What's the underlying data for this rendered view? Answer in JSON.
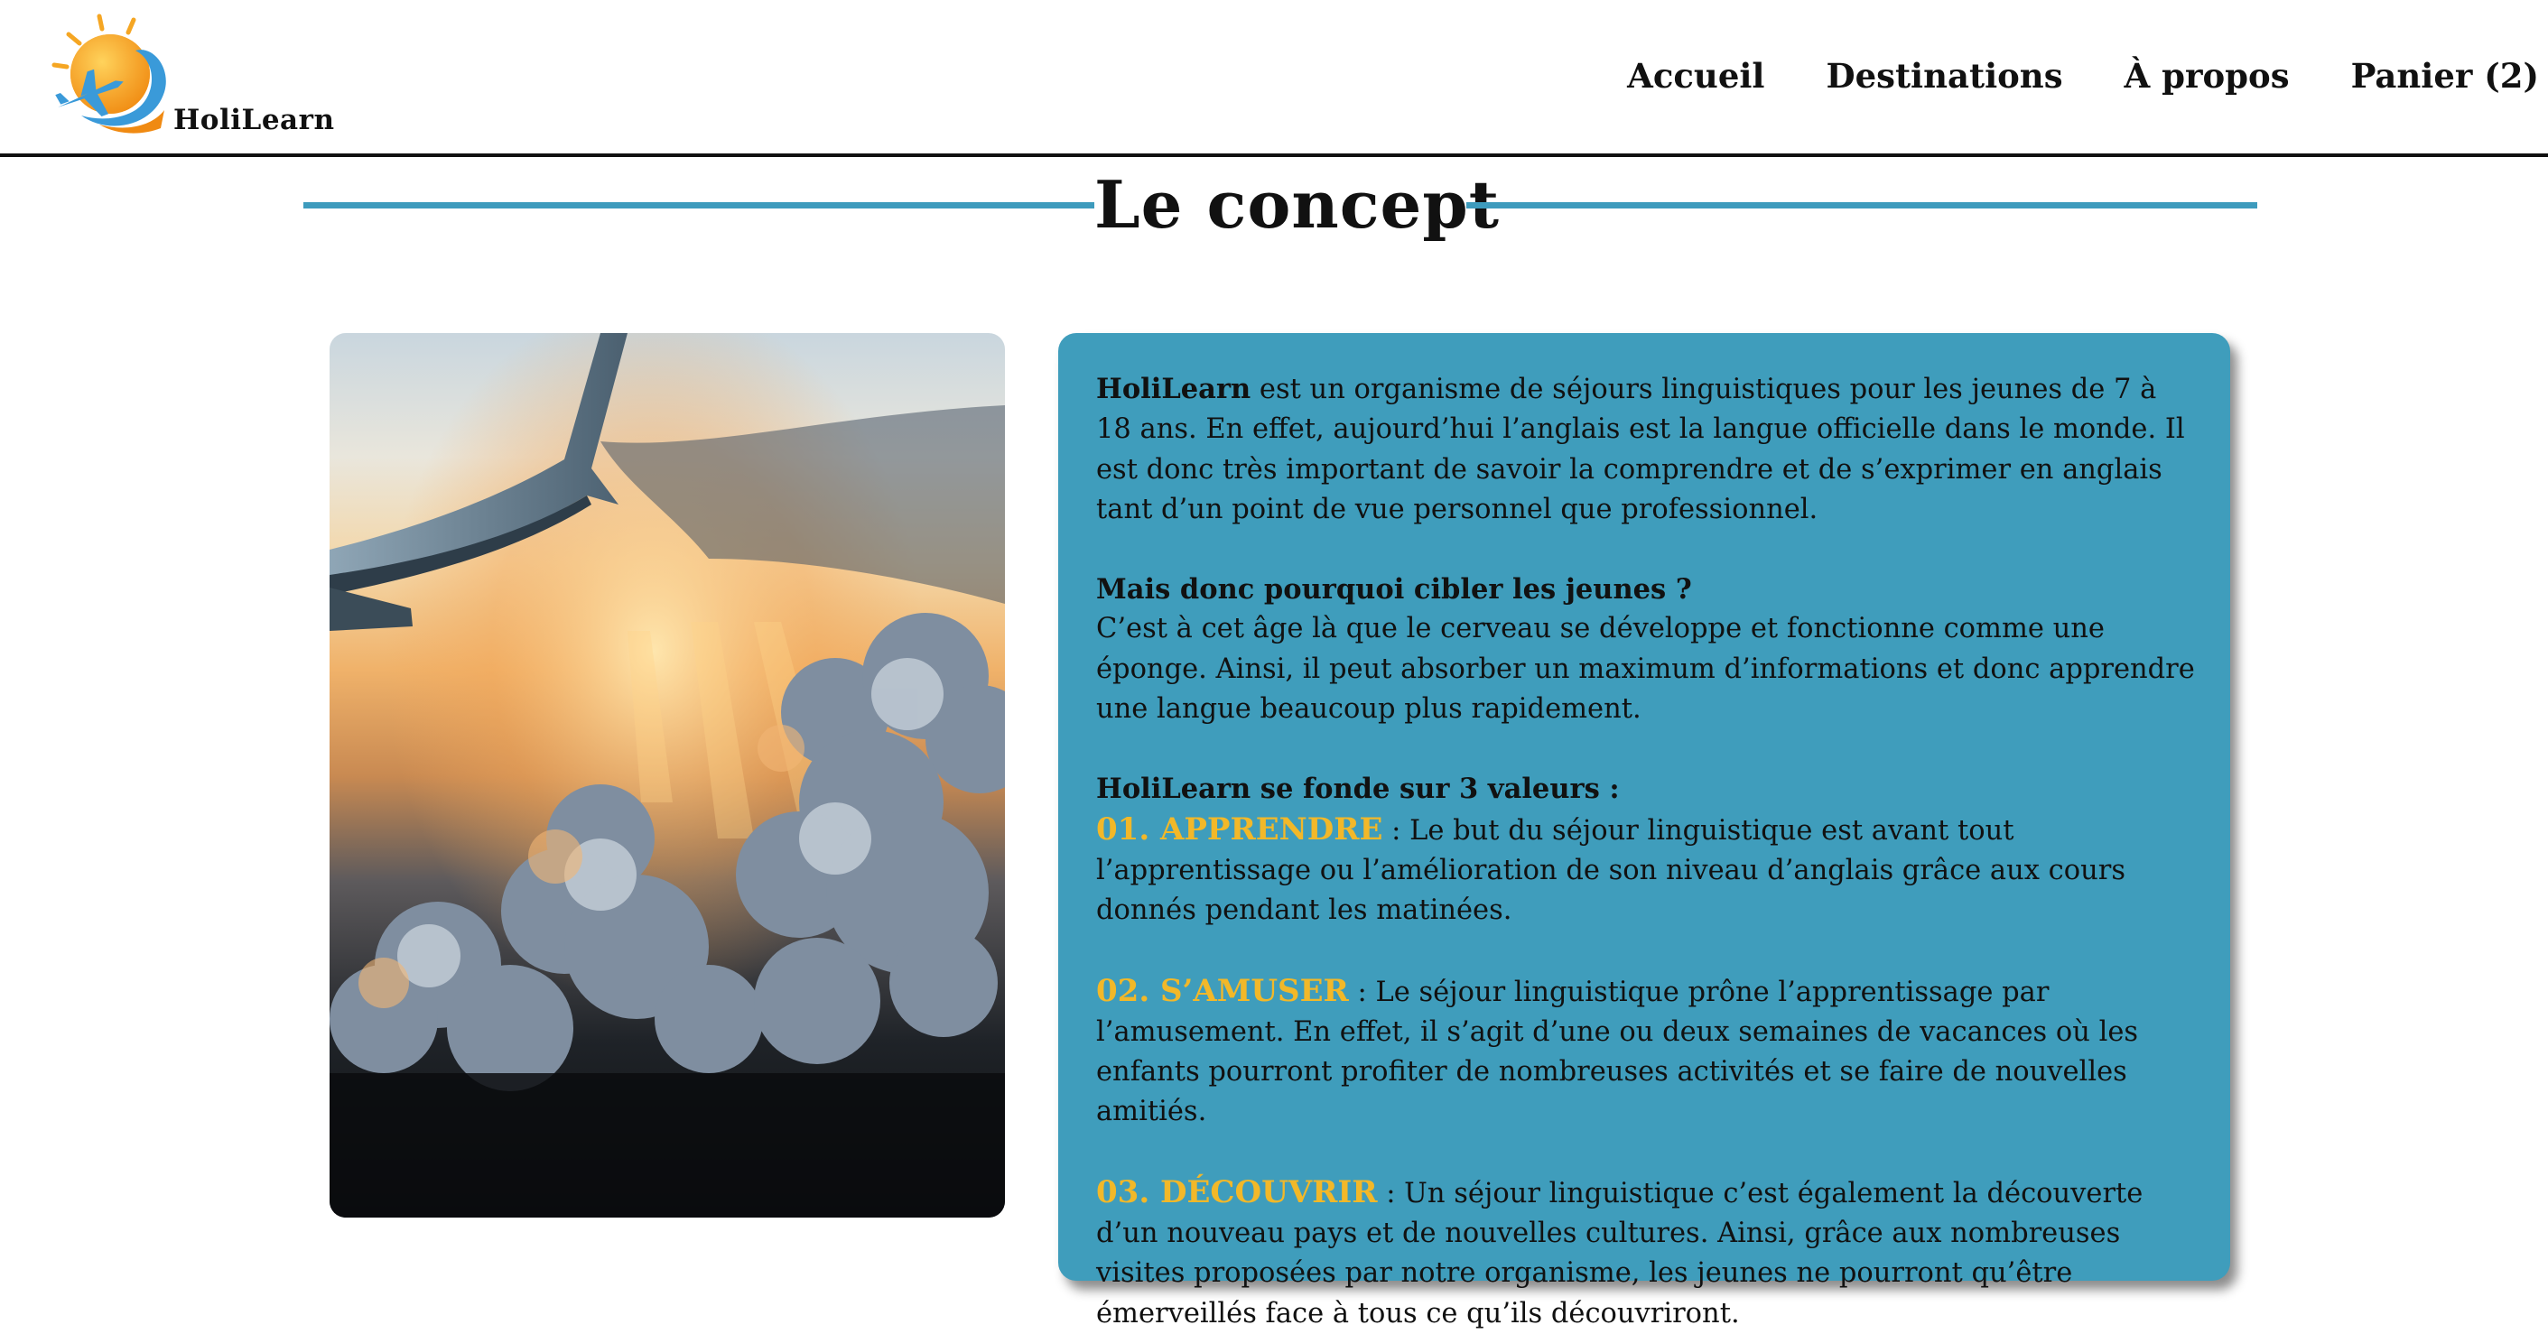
{
  "header": {
    "brand": "HoliLearn",
    "nav": [
      {
        "label": "Accueil"
      },
      {
        "label": "Destinations"
      },
      {
        "label": "À propos"
      },
      {
        "label": "Panier (2)"
      }
    ]
  },
  "main": {
    "title": "Le concept",
    "intro": {
      "brand": "HoliLearn",
      "text": " est un organisme de séjours linguistiques pour les jeunes de 7 à 18 ans. En effet, aujourd’hui l’anglais est la langue officielle dans le monde. Il est donc très important de savoir la comprendre et de s’exprimer en anglais tant d’un point de vue personnel que professionnel."
    },
    "why": {
      "heading": "Mais donc pourquoi cibler les jeunes ?",
      "text": "C’est à cet âge là que le cerveau se développe et fonctionne comme une éponge. Ainsi, il peut absorber un maximum d’informations et donc apprendre une langue beaucoup plus rapidement."
    },
    "values": {
      "heading": "HoliLearn se fonde sur 3 valeurs :",
      "items": [
        {
          "keyword": "01. APPRENDRE",
          "text": " : Le but du séjour linguistique est avant tout l’apprentissage ou l’amélioration de son niveau d’anglais grâce aux cours donnés pendant les matinées."
        },
        {
          "keyword": "02. S’AMUSER",
          "text": " : Le séjour linguistique prône l’apprentissage par l’amusement. En effet, il s’agit d’une ou deux semaines de vacances où les enfants pourront profiter de nombreuses activités et se faire de nouvelles amitiés."
        },
        {
          "keyword": "03. DÉCOUVRIR",
          "text": " : Un séjour linguistique c’est également la découverte d’un nouveau pays et de nouvelles cultures. Ainsi, grâce aux nombreuses visites proposées par notre organisme, les jeunes ne pourront qu’être émerveillés face à tous ce qu’ils découvriront."
        }
      ]
    }
  },
  "colors": {
    "accent": "#3f9dbc",
    "title_line": "#3d9bbd",
    "keyword": "#f2b829",
    "logo_sun": "#f5a623",
    "logo_plane": "#3a9ad9"
  },
  "icons": {
    "logo": "sun-airplane-logo",
    "photo": "airplane-wing-over-clouds-photo"
  }
}
